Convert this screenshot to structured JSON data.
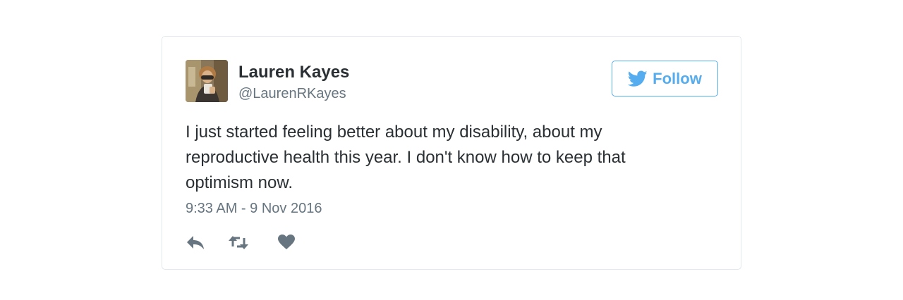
{
  "tweet": {
    "user": {
      "name": "Lauren Kayes",
      "handle": "@LaurenRKayes",
      "avatar_icon": "profile-photo"
    },
    "follow_button": {
      "label": "Follow",
      "icon": "twitter-bird-icon"
    },
    "text": "I just started feeling better about my disability, about my reproductive health this year. I don't know how to keep that optimism now.",
    "timestamp": "9:33 AM - 9 Nov 2016",
    "actions": [
      {
        "name": "reply",
        "icon": "reply-icon"
      },
      {
        "name": "retweet",
        "icon": "retweet-icon"
      },
      {
        "name": "like",
        "icon": "heart-icon"
      }
    ]
  },
  "colors": {
    "accent": "#55acee",
    "text_primary": "#292f33",
    "text_secondary": "#66757f",
    "card_border": "#e1e8ed",
    "action_icon": "#66757f"
  }
}
